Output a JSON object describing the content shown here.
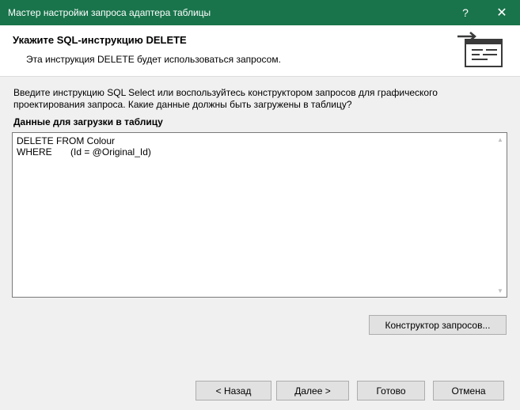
{
  "window": {
    "title": "Мастер настройки запроса адаптера таблицы",
    "help_glyph": "?",
    "close_glyph": "✕"
  },
  "header": {
    "title": "Укажите SQL-инструкцию DELETE",
    "subtitle": "Эта инструкция DELETE будет использоваться запросом.",
    "icon": "wizard-sql-icon"
  },
  "body": {
    "instructions": "Введите инструкцию SQL Select или воспользуйтесь конструктором запросов для графического проектирования запроса. Какие данные должны быть загружены в таблицу?",
    "section_label": "Данные для загрузки в таблицу",
    "sql_text": "DELETE FROM Colour\nWHERE       (Id = @Original_Id)"
  },
  "buttons": {
    "query_builder": "Конструктор запросов...",
    "back": "< Назад",
    "next": "Далее >",
    "finish": "Готово",
    "cancel": "Отмена"
  },
  "colors": {
    "titlebar": "#19744b",
    "dialog_bg": "#f0f0f0",
    "header_bg": "#ffffff"
  }
}
